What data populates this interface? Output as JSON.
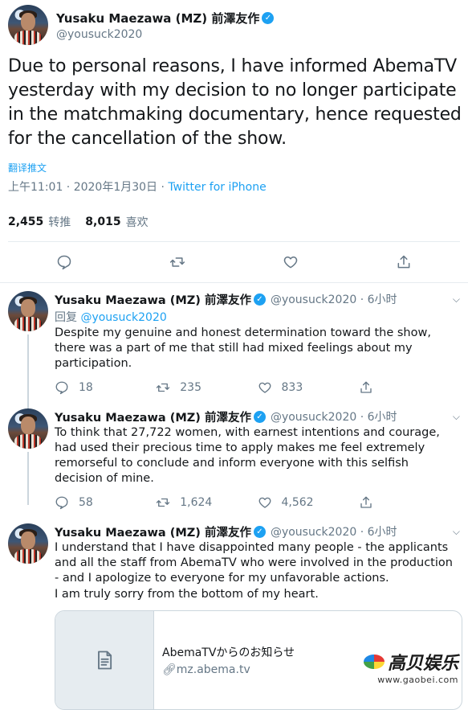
{
  "main_tweet": {
    "display_name": "Yusaku Maezawa (MZ) 前澤友作",
    "handle": "@yousuck2020",
    "text": "Due to personal reasons, I have informed AbemaTV yesterday with my decision to no longer participate in the matchmaking documentary, hence requested for the cancellation of the show.",
    "translate_label": "翻译推文",
    "timestamp": "上午11:01 · 2020年1月30日 · ",
    "source": "Twitter for iPhone",
    "retweets": "2,455",
    "retweets_label": "转推",
    "likes": "8,015",
    "likes_label": "喜欢"
  },
  "replies": [
    {
      "display_name": "Yusaku Maezawa (MZ) 前澤友作",
      "meta": "@yousuck2020 · 6小时",
      "replying_prefix": "回复 ",
      "replying_to": "@yousuck2020",
      "text": "Despite my genuine and honest determination toward the show, there was a part of me that still had mixed feelings about my participation.",
      "reply_count": "18",
      "retweet_count": "235",
      "like_count": "833"
    },
    {
      "display_name": "Yusaku Maezawa (MZ) 前澤友作",
      "meta": "@yousuck2020 · 6小时",
      "text": "To think that 27,722 women, with earnest intentions and courage, had used their precious time to apply makes me feel extremely remorseful to conclude and inform everyone with this selfish decision of mine.",
      "reply_count": "58",
      "retweet_count": "1,624",
      "like_count": "4,562"
    },
    {
      "display_name": "Yusaku Maezawa (MZ) 前澤友作",
      "meta": "@yousuck2020 · 6小时",
      "text": "I understand that I have disappointed many people - the applicants and all the staff from AbemaTV who were involved in the production - and I apologize to everyone for my unfavorable actions.",
      "text2": "I am truly sorry from the bottom of my heart.",
      "card": {
        "title": "AbemaTVからのお知らせ",
        "url": "mz.abema.tv"
      }
    }
  ],
  "watermark": {
    "text": "高贝娱乐",
    "url": "www.gaobei.com"
  },
  "colors": {
    "accent": "#1da1f2",
    "secondary_text": "#657786",
    "divider": "#e6ecf0"
  }
}
